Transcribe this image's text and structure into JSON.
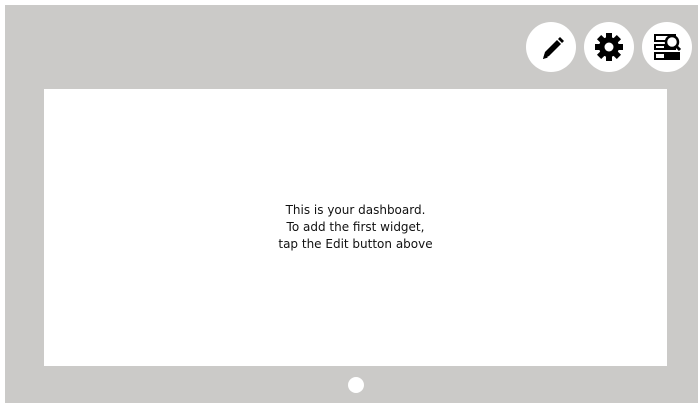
{
  "toolbar": {
    "buttons": [
      {
        "id": "edit",
        "icon": "pencil-icon"
      },
      {
        "id": "settings",
        "icon": "gear-icon"
      },
      {
        "id": "inspect",
        "icon": "search-list-icon"
      }
    ]
  },
  "dashboard": {
    "empty_message": {
      "line1": "This is your dashboard.",
      "line2": "To add the first widget,",
      "line3": "tap the Edit button above"
    }
  },
  "pager": {
    "pages": 1,
    "current": 1
  },
  "colors": {
    "frame": "#cbcac8",
    "panel": "#ffffff",
    "icon": "#000000"
  }
}
